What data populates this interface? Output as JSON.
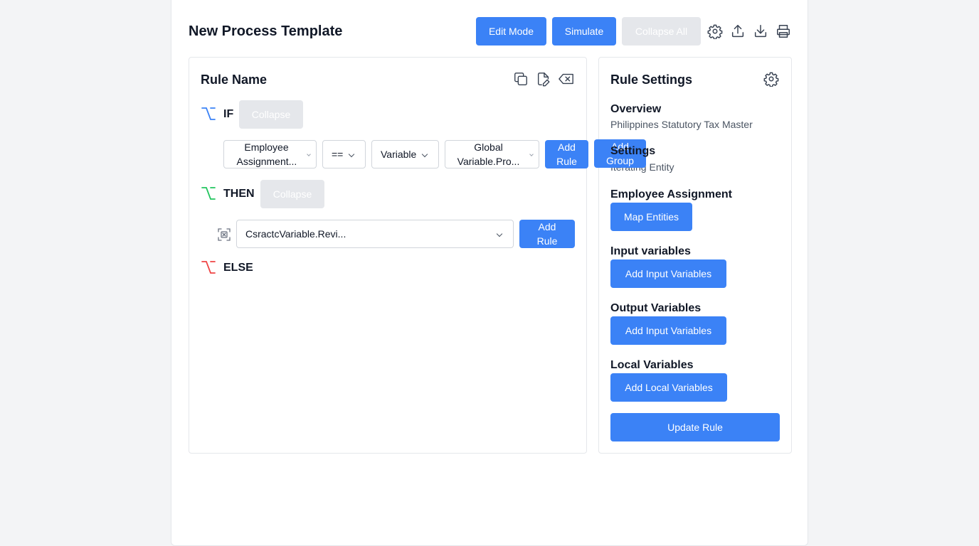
{
  "header": {
    "title": "New Process Template",
    "edit_mode": "Edit Mode",
    "simulate": "Simulate",
    "collapse_all": "Collapse All"
  },
  "icons": {
    "settings": "gear-icon",
    "upload": "upload-icon",
    "download": "download-icon",
    "print": "printer-icon",
    "copy": "copy-icon",
    "edit": "edit-file-icon",
    "delete": "backspace-icon"
  },
  "rule": {
    "name": "Rule Name",
    "if_label": "IF",
    "then_label": "THEN",
    "else_label": "ELSE",
    "collapse_label": "Collapse",
    "condition": {
      "field": "Employee Assignment...",
      "operator": "==",
      "value_type": "Variable",
      "value": "Global Variable.Pro..."
    },
    "add_rule": "Add Rule",
    "add_group": "Add Group",
    "then_action": "CsractcVariable.Revi...",
    "then_add_rule": "Add Rule"
  },
  "settings": {
    "title": "Rule Settings",
    "overview_label": "Overview",
    "overview_value": "Philippines Statutory Tax Master",
    "settings_label": "Settings",
    "settings_value": "Iterating Entity",
    "employee_assignment_label": "Employee Assignment",
    "map_entities": "Map Entities",
    "input_variables_label": "Input variables",
    "add_input_variables": "Add Input Variables",
    "output_variables_label": "Output Variables",
    "add_output_variables": "Add Input Variables",
    "local_variables_label": "Local Variables",
    "add_local_variables": "Add Local Variables",
    "update_rule": "Update Rule"
  },
  "colors": {
    "primary": "#3b82f6",
    "if": "#3b82f6",
    "then": "#22c55e",
    "else": "#ef4444",
    "disabled": "#e5e7eb"
  }
}
